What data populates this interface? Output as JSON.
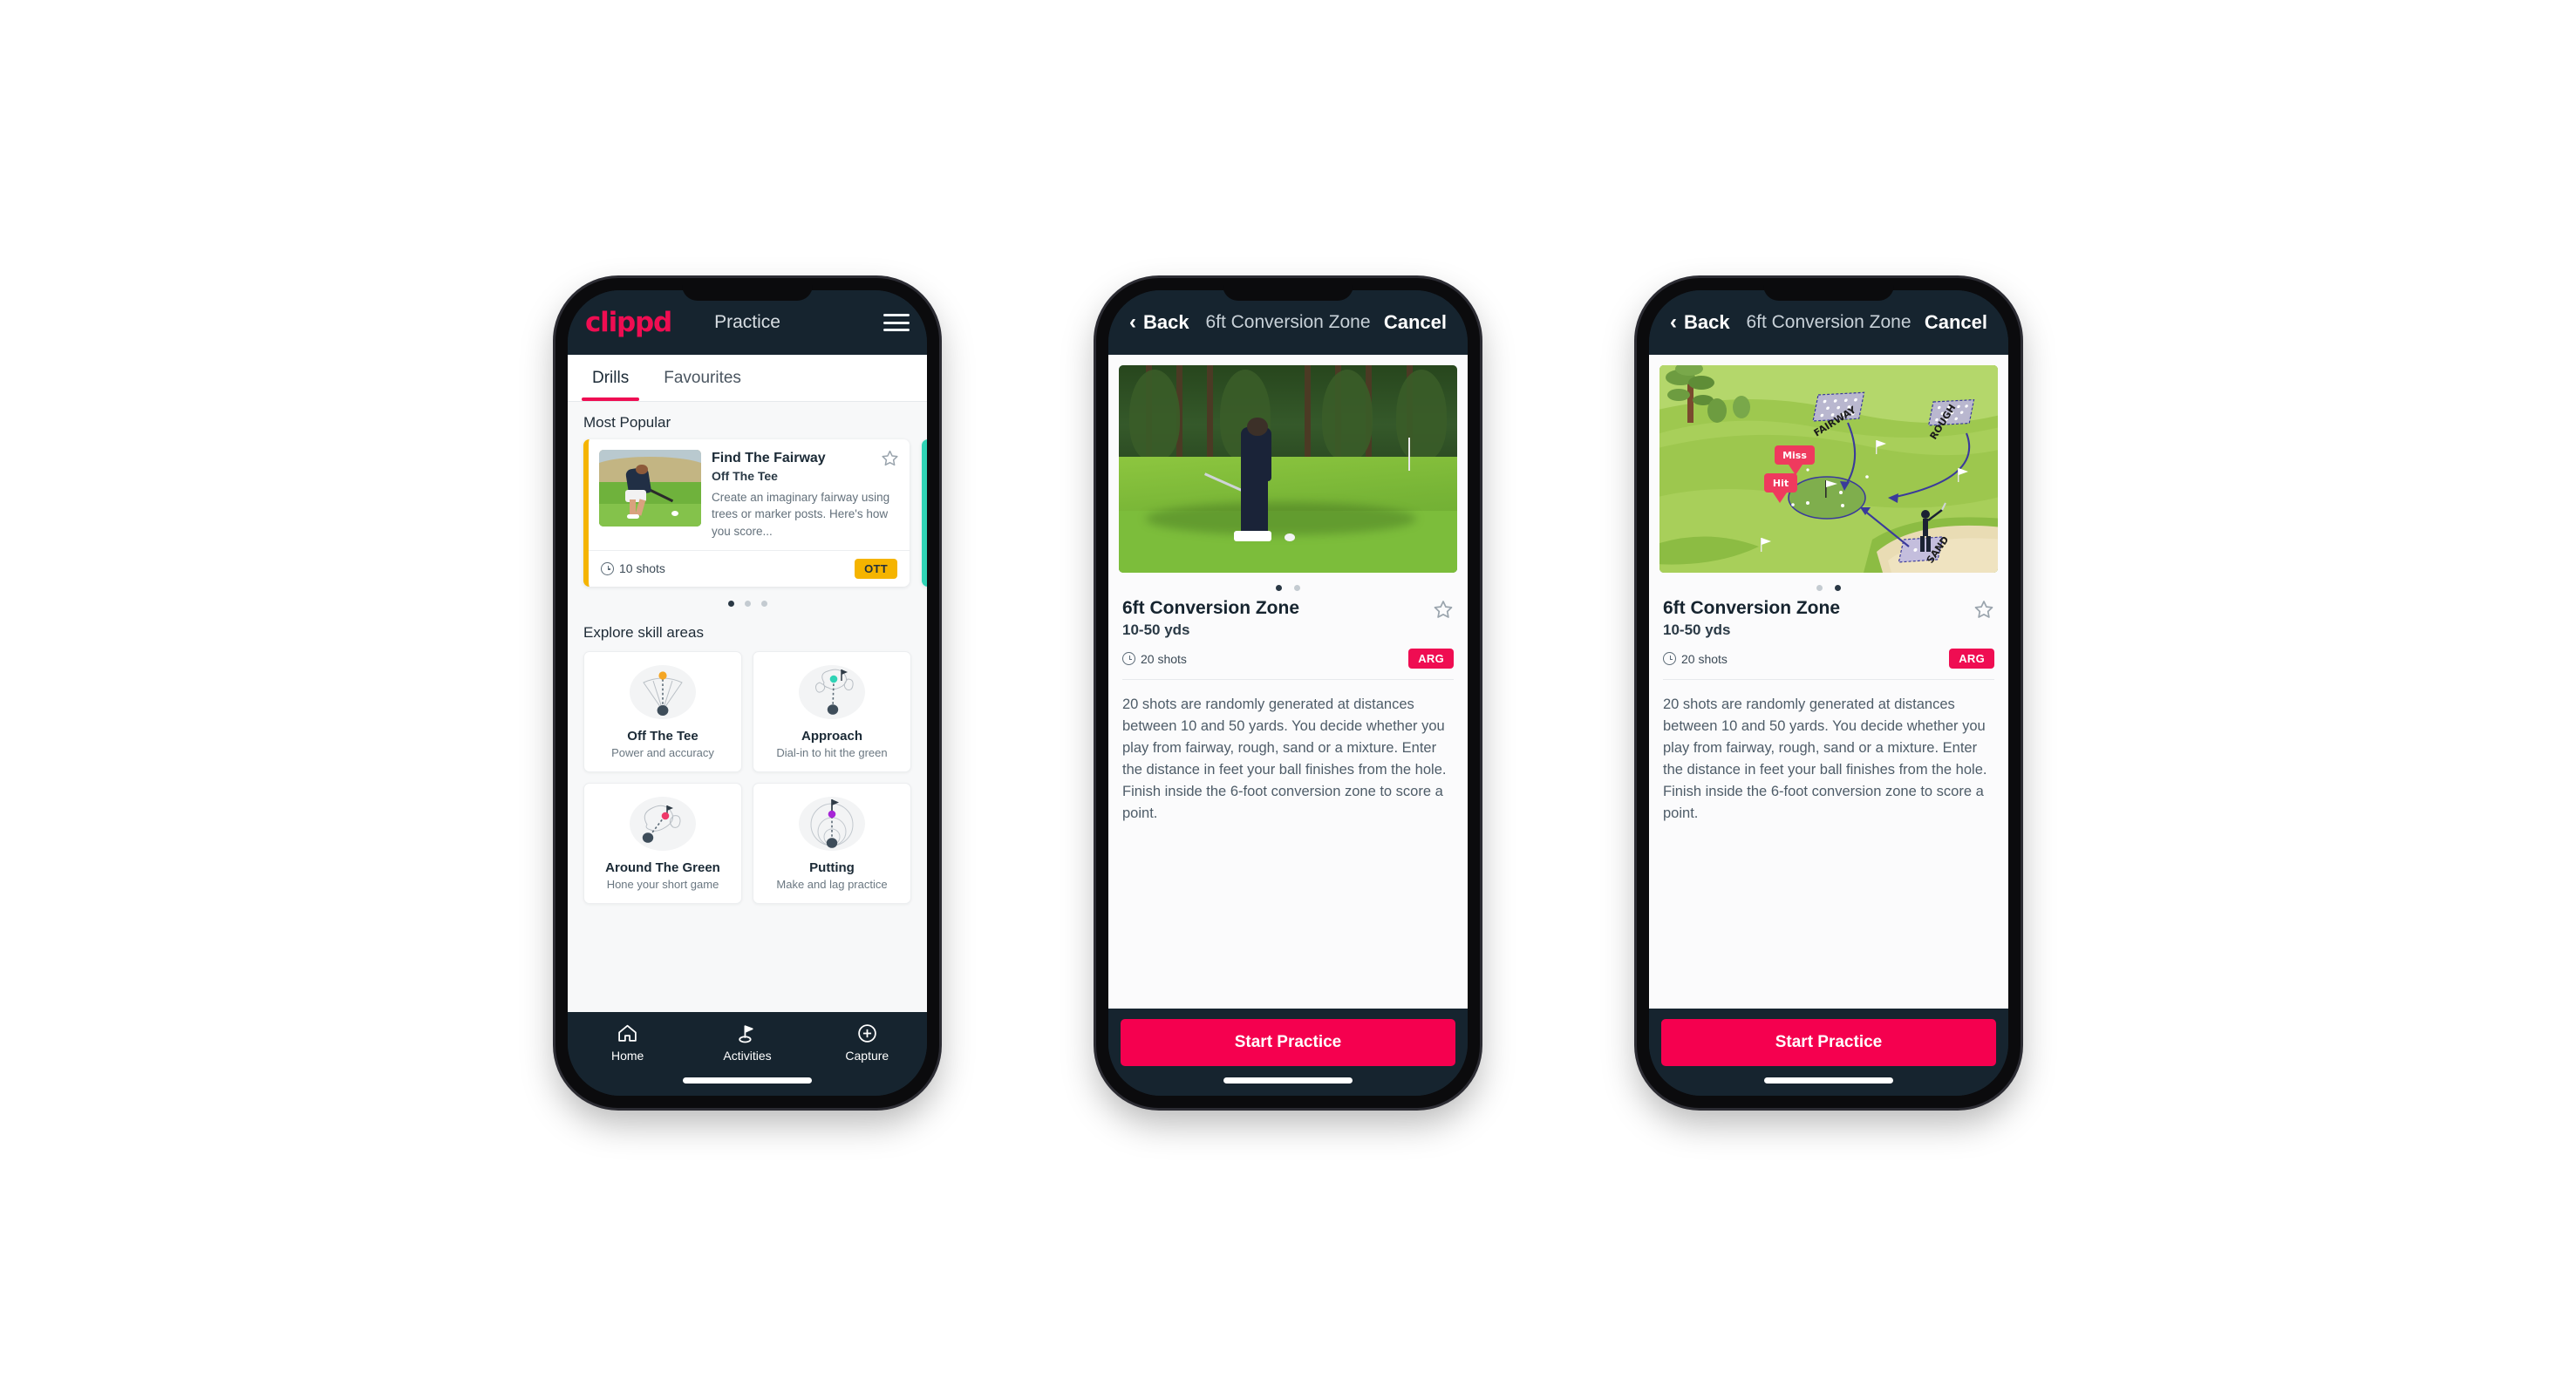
{
  "brand": {
    "name": "clippd",
    "accent": "#ef0d52",
    "dark": "#16242f",
    "ott_chip_color": "#f5b400",
    "arg_chip_color": "#ef0d52",
    "teal": "#2fd3b5"
  },
  "phone1": {
    "appbar": {
      "logo": "clippd",
      "title": "Practice",
      "menu_icon": "hamburger-icon"
    },
    "tabs": [
      {
        "label": "Drills",
        "active": true
      },
      {
        "label": "Favourites",
        "active": false
      }
    ],
    "most_popular": {
      "section_label": "Most Popular",
      "card": {
        "title": "Find The Fairway",
        "subtitle": "Off The Tee",
        "description": "Create an imaginary fairway using trees or marker posts. Here's how you score...",
        "shots": "10 shots",
        "chip": "OTT",
        "star_icon": "star-outline-icon",
        "clock_icon": "clock-icon"
      },
      "dots": [
        true,
        false,
        false
      ]
    },
    "explore": {
      "section_label": "Explore skill areas",
      "cards": [
        {
          "name": "Off The Tee",
          "desc": "Power and accuracy",
          "icon": "tee-fan-icon",
          "dot_color": "#f5a623"
        },
        {
          "name": "Approach",
          "desc": "Dial-in to hit the green",
          "icon": "approach-green-icon",
          "dot_color": "#2fd3b5"
        },
        {
          "name": "Around The Green",
          "desc": "Hone your short game",
          "icon": "chip-green-icon",
          "dot_color": "#ef3a6a"
        },
        {
          "name": "Putting",
          "desc": "Make and lag practice",
          "icon": "putting-rings-icon",
          "dot_color": "#a625d6"
        }
      ]
    },
    "tabbar": [
      {
        "label": "Home",
        "icon": "home-icon",
        "active": false
      },
      {
        "label": "Activities",
        "icon": "flag-golf-icon",
        "active": true
      },
      {
        "label": "Capture",
        "icon": "plus-circle-icon",
        "active": false
      }
    ]
  },
  "phone2": {
    "navbar": {
      "back": "Back",
      "title": "6ft Conversion Zone",
      "cancel": "Cancel",
      "back_icon": "chevron-left-icon"
    },
    "media_type": "photo",
    "dots": [
      true,
      false
    ],
    "detail": {
      "title": "6ft Conversion Zone",
      "yards": "10-50 yds",
      "shots": "20 shots",
      "chip": "ARG",
      "star_icon": "star-outline-icon",
      "clock_icon": "clock-icon",
      "description": "20 shots are randomly generated at distances between 10 and 50 yards. You decide whether you play from fairway, rough, sand or a mixture. Enter the distance in feet your ball finishes from the hole. Finish inside the 6-foot conversion zone to score a point."
    },
    "cta": "Start Practice"
  },
  "phone3": {
    "navbar": {
      "back": "Back",
      "title": "6ft Conversion Zone",
      "cancel": "Cancel",
      "back_icon": "chevron-left-icon"
    },
    "media_type": "illustration",
    "illustration": {
      "labels": [
        "FAIRWAY",
        "ROUGH",
        "SAND"
      ],
      "markers": [
        "Miss",
        "Hit"
      ],
      "marker_color": "#ef3a5e",
      "arrow_color": "#2f2f8f"
    },
    "dots": [
      false,
      true
    ],
    "detail": {
      "title": "6ft Conversion Zone",
      "yards": "10-50 yds",
      "shots": "20 shots",
      "chip": "ARG",
      "star_icon": "star-outline-icon",
      "clock_icon": "clock-icon",
      "description": "20 shots are randomly generated at distances between 10 and 50 yards. You decide whether you play from fairway, rough, sand or a mixture. Enter the distance in feet your ball finishes from the hole. Finish inside the 6-foot conversion zone to score a point."
    },
    "cta": "Start Practice"
  }
}
